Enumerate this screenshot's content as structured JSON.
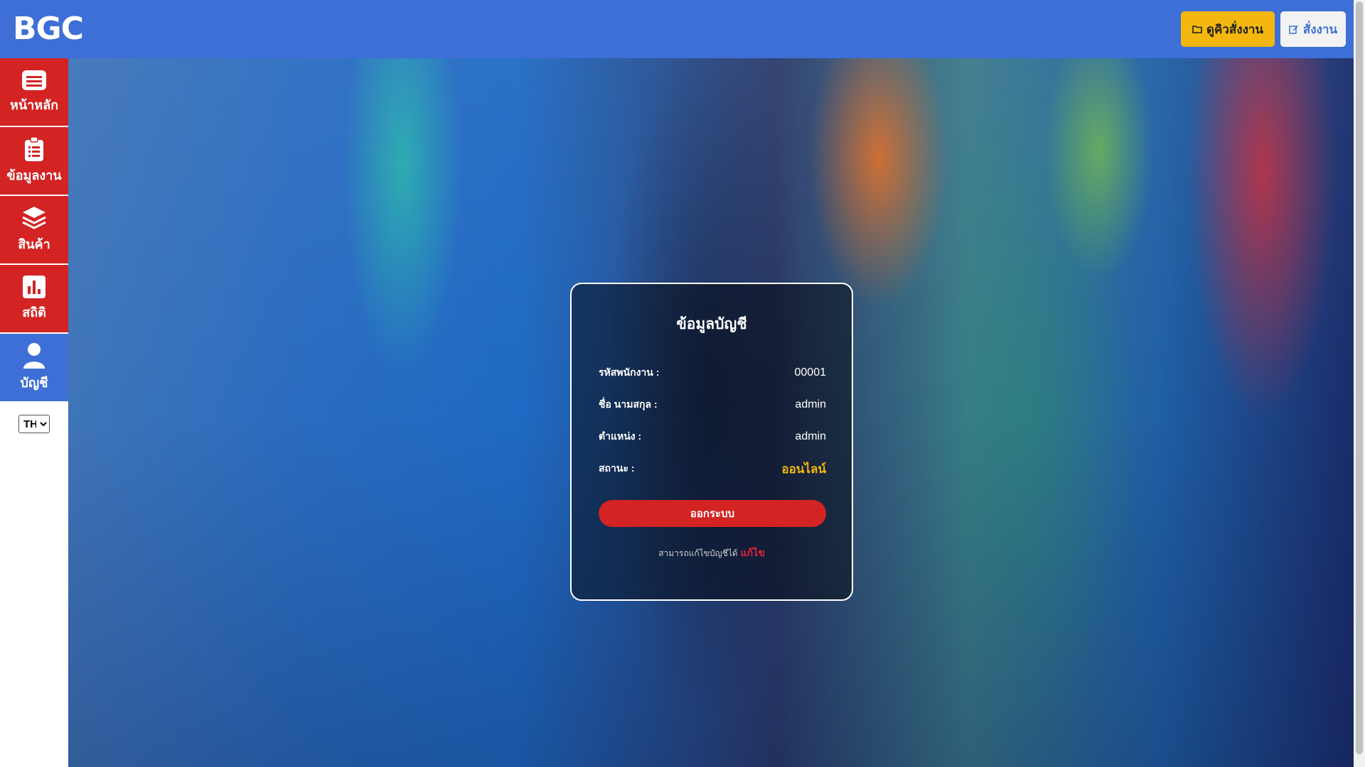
{
  "header": {
    "logo": "BGC",
    "queue_button": "ดูคิวสั่งงาน",
    "order_button": "สั่งงาน",
    "colors": {
      "bar": "#3d6fd6",
      "queue_button": "#f3b70f"
    }
  },
  "sidebar": {
    "items": [
      {
        "label": "หน้าหลัก",
        "icon": "home-icon"
      },
      {
        "label": "ข้อมูลงาน",
        "icon": "clipboard-icon"
      },
      {
        "label": "สินค้า",
        "icon": "layers-icon"
      },
      {
        "label": "สถิติ",
        "icon": "bar-chart-icon"
      },
      {
        "label": "บัญชี",
        "icon": "user-icon",
        "active": true
      }
    ],
    "language": "TH"
  },
  "account": {
    "title": "ข้อมูลบัญชี",
    "rows": [
      {
        "label": "รหัสพนักงาน :",
        "value": "00001"
      },
      {
        "label": "ชื่อ นามสกุล :",
        "value": "admin"
      },
      {
        "label": "ตำแหน่ง :",
        "value": "admin"
      },
      {
        "label": "สถานะ :",
        "value": "ออนไลน์"
      }
    ],
    "logout_button": "ออกระบบ",
    "edit_note": "สามารถแก้ไขบัญชีได้",
    "edit_link": "แก้ไข"
  }
}
